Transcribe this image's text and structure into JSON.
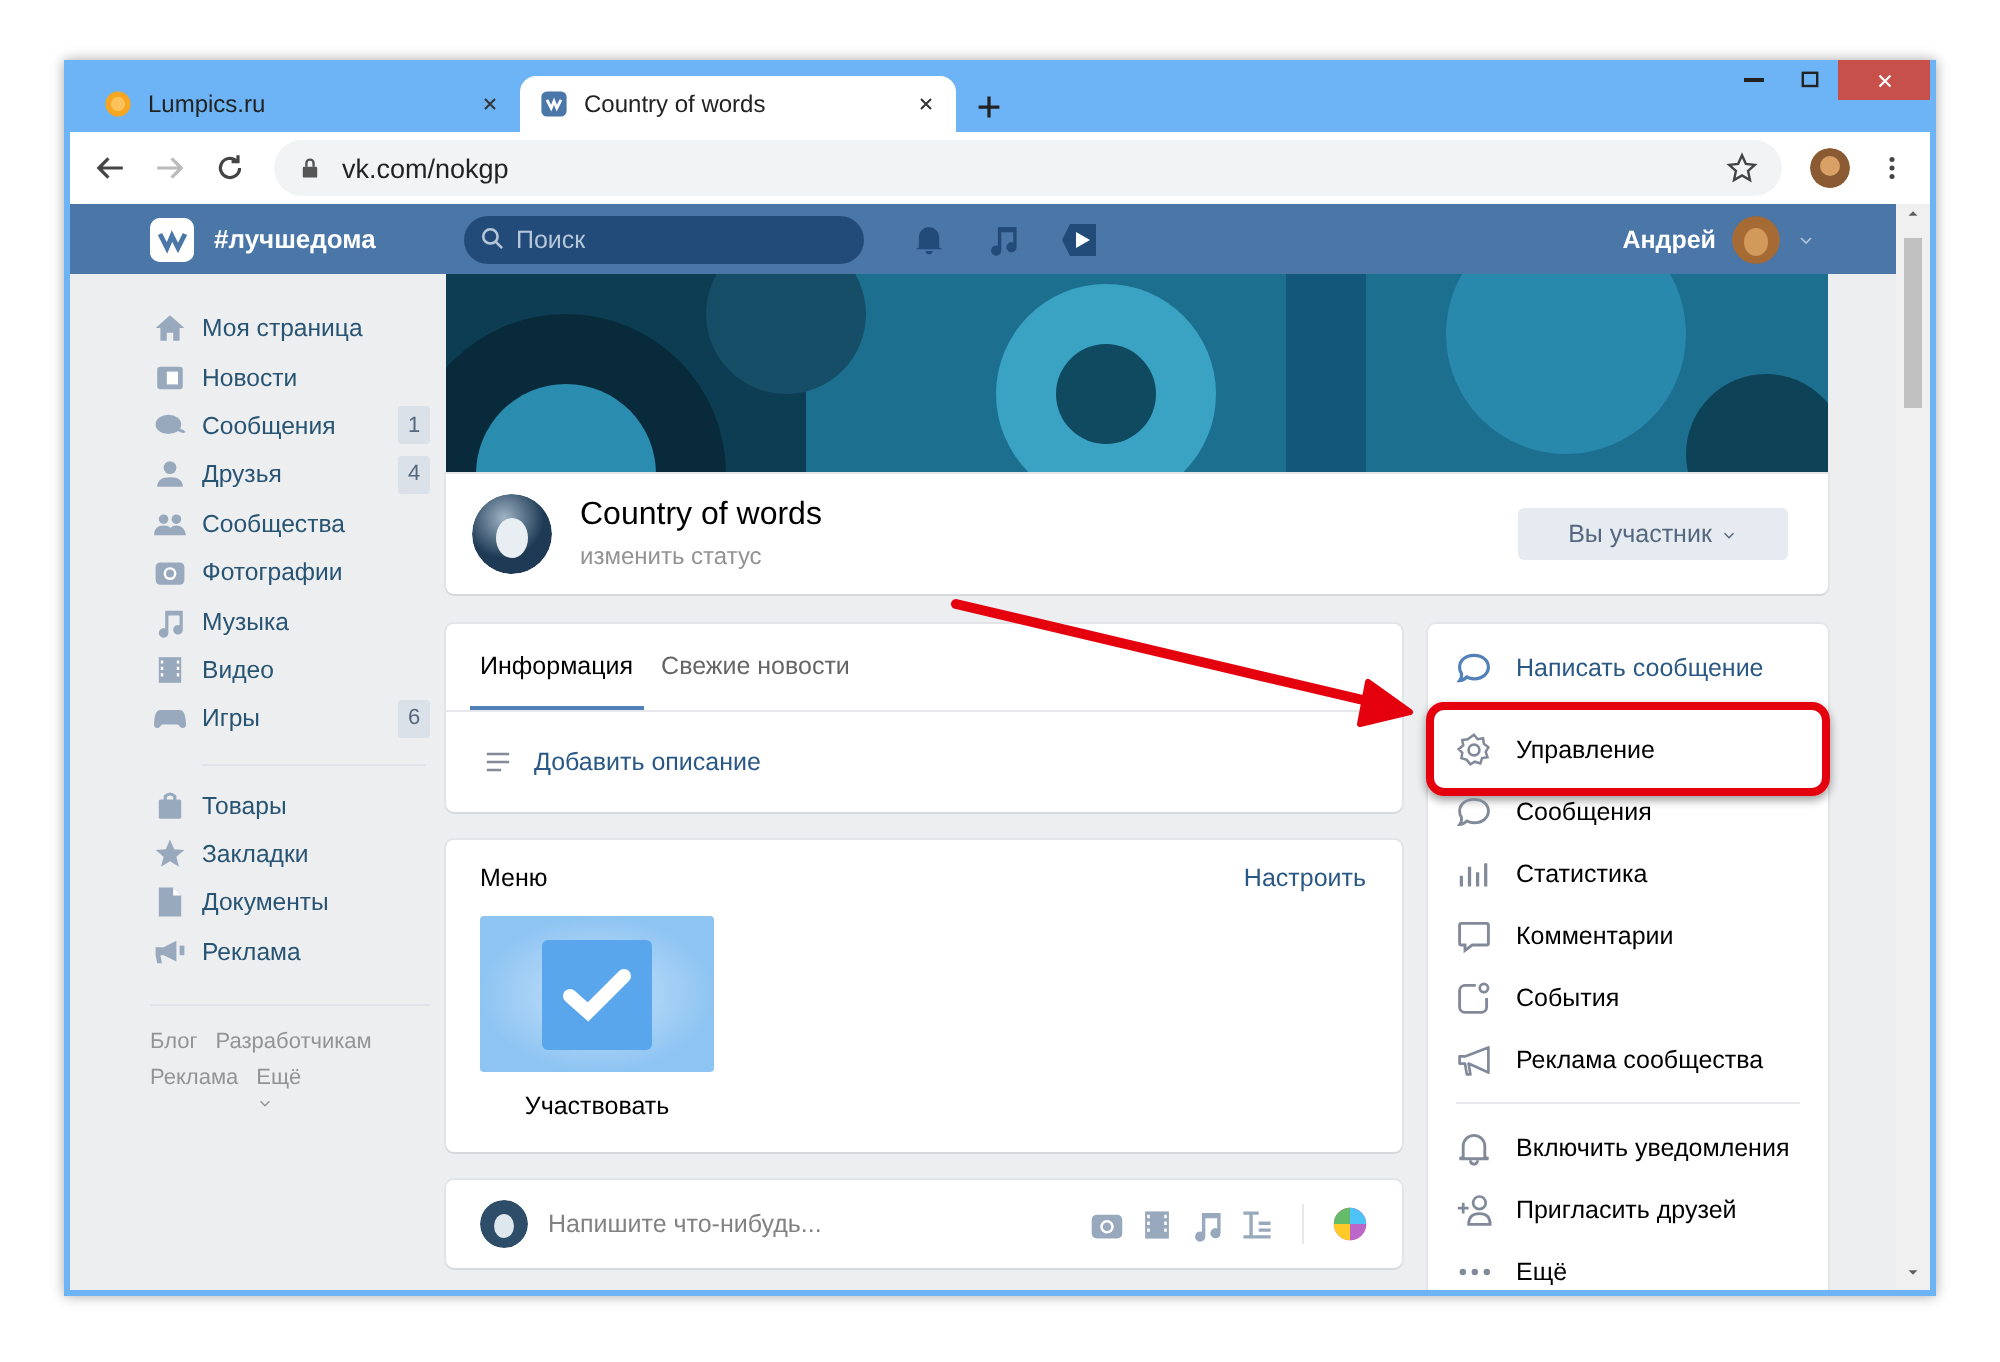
{
  "browser": {
    "tabs": [
      {
        "title": "Lumpics.ru",
        "selected": false,
        "kind": "site"
      },
      {
        "title": "Country of words",
        "selected": true,
        "kind": "vk"
      }
    ],
    "url": "vk.com/nokgp"
  },
  "header": {
    "hashtag": "#лучшедома",
    "search": {
      "placeholder": "Поиск"
    },
    "user": "Андрей"
  },
  "sidebar": {
    "groups": [
      [
        {
          "label": "Моя страница"
        },
        {
          "label": "Новости"
        },
        {
          "label": "Сообщения",
          "count": "1"
        },
        {
          "label": "Друзья",
          "count": "4"
        },
        {
          "label": "Сообщества"
        },
        {
          "label": "Фотографии"
        },
        {
          "label": "Музыка"
        },
        {
          "label": "Видео"
        },
        {
          "label": "Игры",
          "count": "6"
        }
      ],
      [
        {
          "label": "Товары"
        },
        {
          "label": "Закладки"
        },
        {
          "label": "Документы"
        },
        {
          "label": "Реклама"
        }
      ]
    ],
    "footer": [
      "Блог",
      "Разработчикам",
      "Реклама",
      "Ещё"
    ]
  },
  "group": {
    "name": "Country of words",
    "status": "изменить статус",
    "member_button": "Вы участник"
  },
  "info": {
    "tabs": [
      {
        "label": "Информация",
        "selected": true
      },
      {
        "label": "Свежие новости",
        "selected": false
      }
    ],
    "add_description": "Добавить описание"
  },
  "menu": {
    "title": "Меню",
    "action": "Настроить",
    "items": [
      {
        "label": "Участвовать"
      }
    ]
  },
  "composer": {
    "placeholder": "Напишите что-нибудь..."
  },
  "actions": {
    "groups": [
      [
        {
          "label": "Написать сообщение",
          "kind": "primary",
          "highlighted": false
        },
        {
          "label": "Управление",
          "kind": "normal",
          "highlighted": true
        },
        {
          "label": "Сообщения",
          "kind": "normal",
          "highlighted": false
        },
        {
          "label": "Статистика",
          "kind": "normal",
          "highlighted": false
        },
        {
          "label": "Комментарии",
          "kind": "normal",
          "highlighted": false
        },
        {
          "label": "События",
          "kind": "normal",
          "highlighted": false
        },
        {
          "label": "Реклама сообщества",
          "kind": "normal",
          "highlighted": false
        }
      ],
      [
        {
          "label": "Включить уведомления",
          "kind": "normal",
          "highlighted": false
        },
        {
          "label": "Пригласить друзей",
          "kind": "normal",
          "highlighted": false
        },
        {
          "label": "Ещё",
          "kind": "normal",
          "highlighted": false
        }
      ]
    ]
  }
}
